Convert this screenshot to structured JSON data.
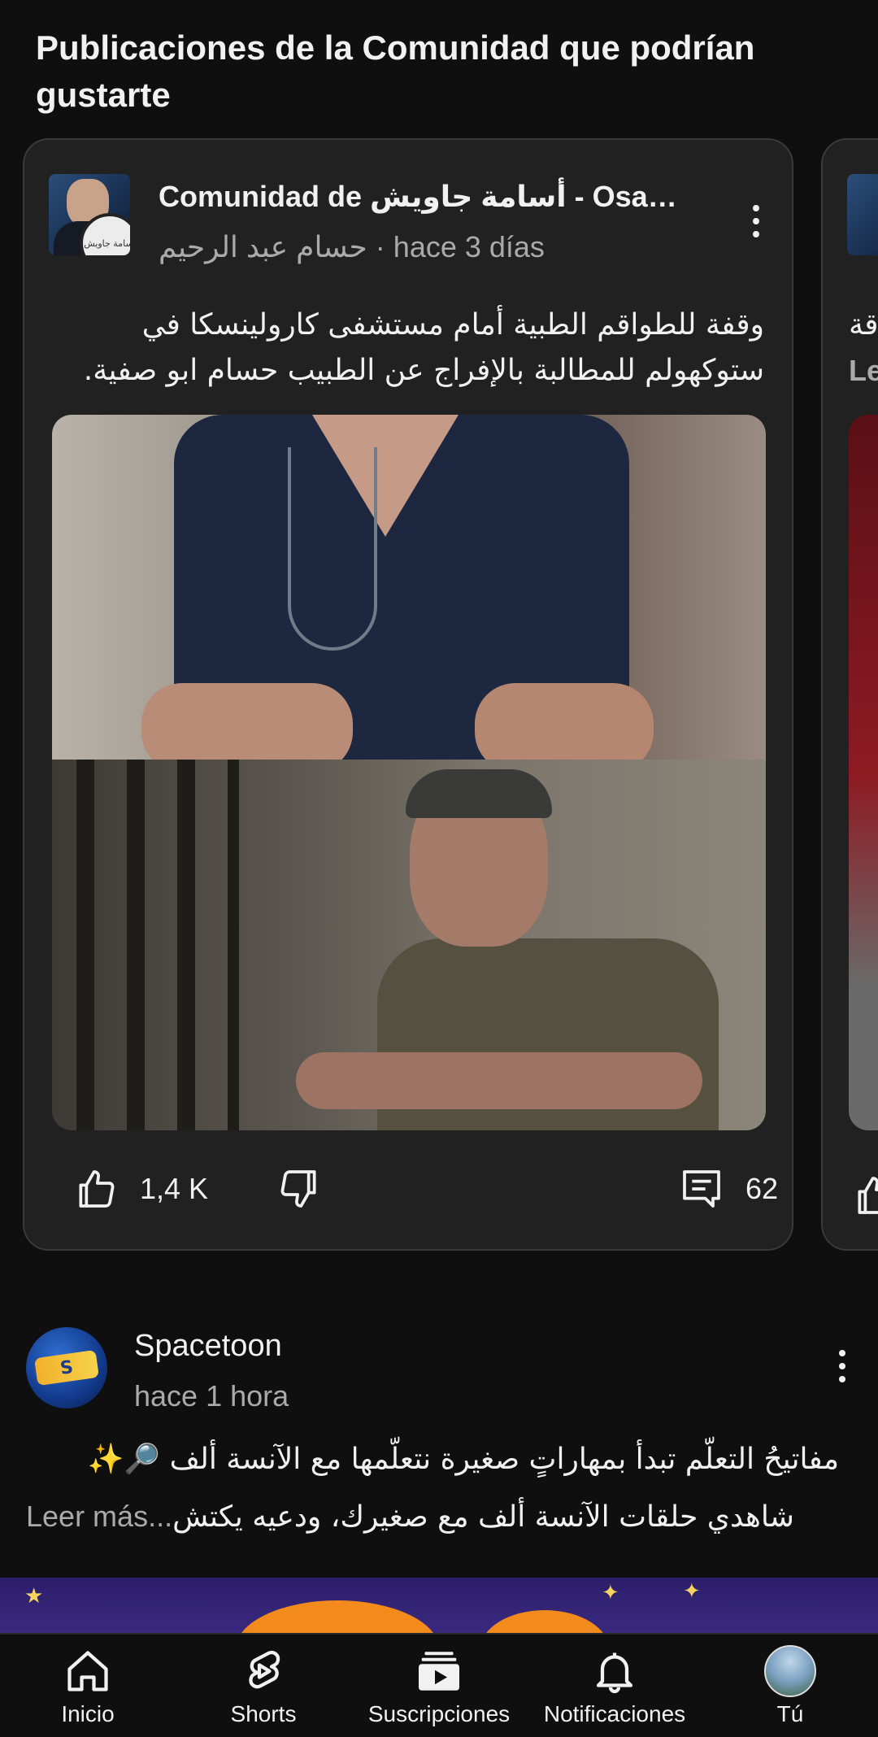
{
  "section": {
    "title": "Publicaciones de la Comunidad que podrían gustarte"
  },
  "community_post": {
    "channel_prefix": "Comunidad de",
    "channel_name": "أسامة جاويش - Osama ...",
    "author": "حسام عبد الرحيم",
    "time": "hace 3 días",
    "text": "وقفة للطواقم الطبية أمام مستشفى كارولينسكا في ستوكهولم للمطالبة بالإفراج عن الطبيب حسام ابو صفية.",
    "likes": "1,4 K",
    "comments": "62",
    "avatar_seal_text": "أسامة جاويش"
  },
  "peek_post": {
    "text_fragment": "قة",
    "more_fragment": "Le"
  },
  "post": {
    "channel": "Spacetoon",
    "time": "hace 1 hora",
    "line1": "مفاتيحُ التعلّم تبدأ بمهاراتٍ صغيرة نتعلّمها مع الآنسة ألف 🔎✨",
    "line2_text": "شاهدي حلقات الآنسة ألف مع صغيرك، ودعيه يكتش",
    "read_more": "...Leer más",
    "logo_text": "S"
  },
  "nav": {
    "home": "Inicio",
    "shorts": "Shorts",
    "subscriptions": "Suscripciones",
    "notifications": "Notificaciones",
    "you": "Tú"
  },
  "colors": {
    "background": "#0f0f0f",
    "card": "#212121",
    "secondary_text": "#aaaaaa"
  },
  "icons": [
    "more-vert-icon",
    "thumb-up-icon",
    "thumb-down-icon",
    "comment-icon",
    "home-icon",
    "shorts-icon",
    "subscriptions-icon",
    "bell-icon"
  ]
}
